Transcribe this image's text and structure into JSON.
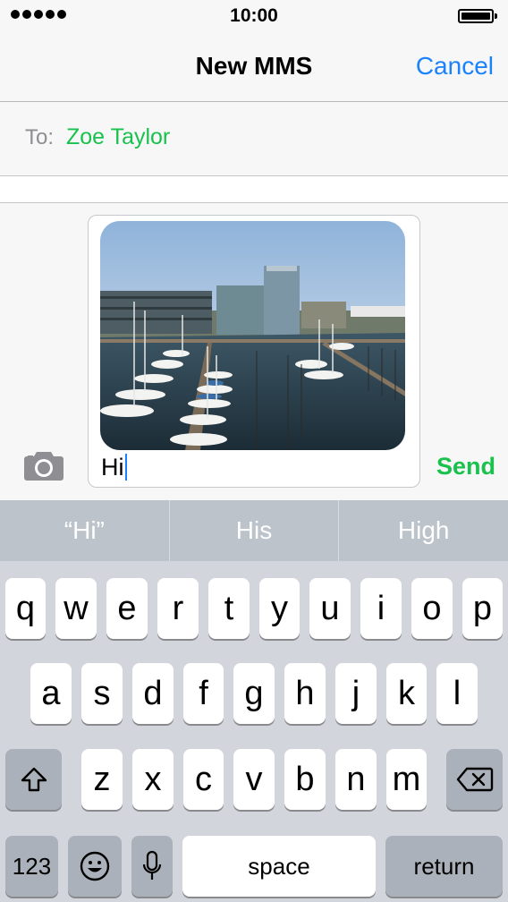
{
  "status_bar": {
    "time": "10:00"
  },
  "nav": {
    "title": "New MMS",
    "cancel_label": "Cancel"
  },
  "recipients": {
    "to_label": "To:",
    "name": "Zoe Taylor"
  },
  "compose": {
    "attachment_icon": "camera-icon",
    "image_alt": "Photo of a marina with sailboats and office buildings",
    "message_text": "Hi",
    "send_label": "Send"
  },
  "predictive": {
    "suggestions": [
      "“Hi”",
      "His",
      "High"
    ]
  },
  "keyboard": {
    "row1": [
      "q",
      "w",
      "e",
      "r",
      "t",
      "y",
      "u",
      "i",
      "o",
      "p"
    ],
    "row2": [
      "a",
      "s",
      "d",
      "f",
      "g",
      "h",
      "j",
      "k",
      "l"
    ],
    "row3": [
      "z",
      "x",
      "c",
      "v",
      "b",
      "n",
      "m"
    ],
    "shift_icon": "shift-icon",
    "delete_icon": "delete-icon",
    "numbers_label": "123",
    "emoji_icon": "emoji-icon",
    "dictation_icon": "microphone-icon",
    "space_label": "space",
    "return_label": "return"
  },
  "colors": {
    "accent_blue": "#1a82fb",
    "imessage_green": "#19c14d",
    "keyboard_bg": "#d2d5db"
  }
}
